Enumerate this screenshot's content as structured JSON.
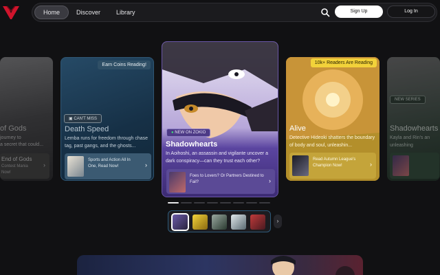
{
  "nav": {
    "links": [
      "Home",
      "Discover",
      "Library"
    ],
    "signup_label": "Sign Up",
    "login_label": "Log In",
    "logo_icon": "red-v-logo",
    "search_icon": "search-icon"
  },
  "cards": {
    "gods": {
      "title": "of Gods",
      "desc1": "journey to",
      "desc2": "a secret that could...",
      "promo_title": "End of Gods",
      "promo_line1": "Contest Mania",
      "promo_line2": "Now!"
    },
    "death": {
      "tag": "Earn Coins Reading!",
      "badge": "CAN'T MISS",
      "title": "Death Speed",
      "desc": "Lemba runs for freedom through chase tag, past gangs, and the ghosts...",
      "promo": "Sports and Action All In One, Read Now!"
    },
    "shadow": {
      "badge": "NEW ON ZOKIO",
      "title": "Shadowhearts",
      "desc": "In Aoihoshi, an assassin and vigilante uncover a dark conspiracy—can they trust each other?",
      "promo": "Foes to Lovers? Or Partners Destined to Fail?"
    },
    "alive": {
      "tag": "10k+ Readers Are Reading",
      "title": "Alive",
      "desc": "Detective Hideoki shatters the boundary of body and soul, unleashin...",
      "promo": "Read Autumn League's Champion Now!"
    },
    "right": {
      "badge": "NEW SERIES",
      "title": "Shadowhearts",
      "desc": "Kayla and Rin's an unleashing"
    }
  },
  "carousel": {
    "count": 8,
    "active": 0
  },
  "colors": {
    "accent": "#6a56a8",
    "brand_red": "#d0142c",
    "alive_tag": "#f2d23a"
  }
}
